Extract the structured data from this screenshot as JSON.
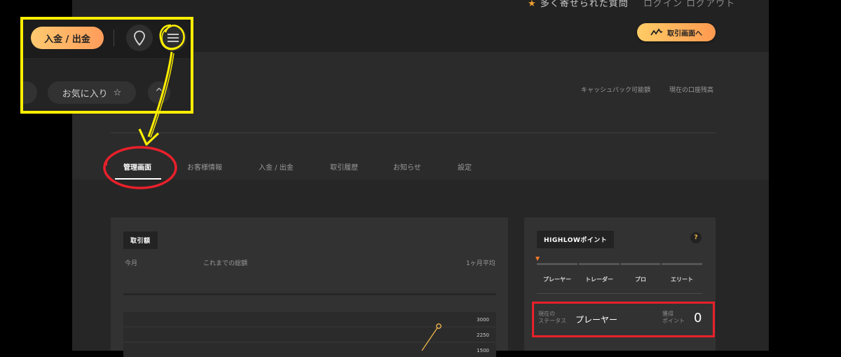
{
  "top_notice": {
    "text": "多く寄せられた質問",
    "login": "ログイン ログアウト"
  },
  "header": {
    "trade_button": "取引画面へ"
  },
  "summary": {
    "cashback_label": "キャッシュバック可能額",
    "balance_label": "現在の口座残高"
  },
  "tabs": [
    {
      "label": "管理画面",
      "active": true
    },
    {
      "label": "お客様情報",
      "active": false
    },
    {
      "label": "入金 / 出金",
      "active": false
    },
    {
      "label": "取引履歴",
      "active": false
    },
    {
      "label": "お知らせ",
      "active": false
    },
    {
      "label": "設定",
      "active": false
    }
  ],
  "trade_panel": {
    "tag": "取引額",
    "col_month": "今月",
    "col_total": "これまでの総額",
    "col_avg": "1ヶ月平均",
    "axis_ticks": [
      "3000",
      "2250",
      "1500"
    ]
  },
  "points_panel": {
    "tag": "HIGHLOWポイント",
    "help": "?",
    "levels": [
      "プレーヤー",
      "トレーダー",
      "プロ",
      "エリート"
    ],
    "status_label_1": "現在の",
    "status_label_2": "ステータス",
    "status_value": "プレーヤー",
    "points_label_1": "獲得",
    "points_label_2": "ポイント",
    "points_value": "0"
  },
  "inset": {
    "deposit_button": "入金 / 出金",
    "favorites_button": "お気に入り",
    "favorites_star": "☆",
    "chevron": "^"
  },
  "colors": {
    "accent_gradient_start": "#ffcc66",
    "accent_gradient_end": "#ff9950",
    "annotation_yellow": "#ffee00",
    "annotation_red": "#e8202a",
    "progress_marker": "#ff7a2e"
  },
  "icons": [
    "trade-chart-icon",
    "location-pin-icon",
    "hamburger-menu-icon",
    "star-icon",
    "chevron-up-icon",
    "help-icon"
  ]
}
